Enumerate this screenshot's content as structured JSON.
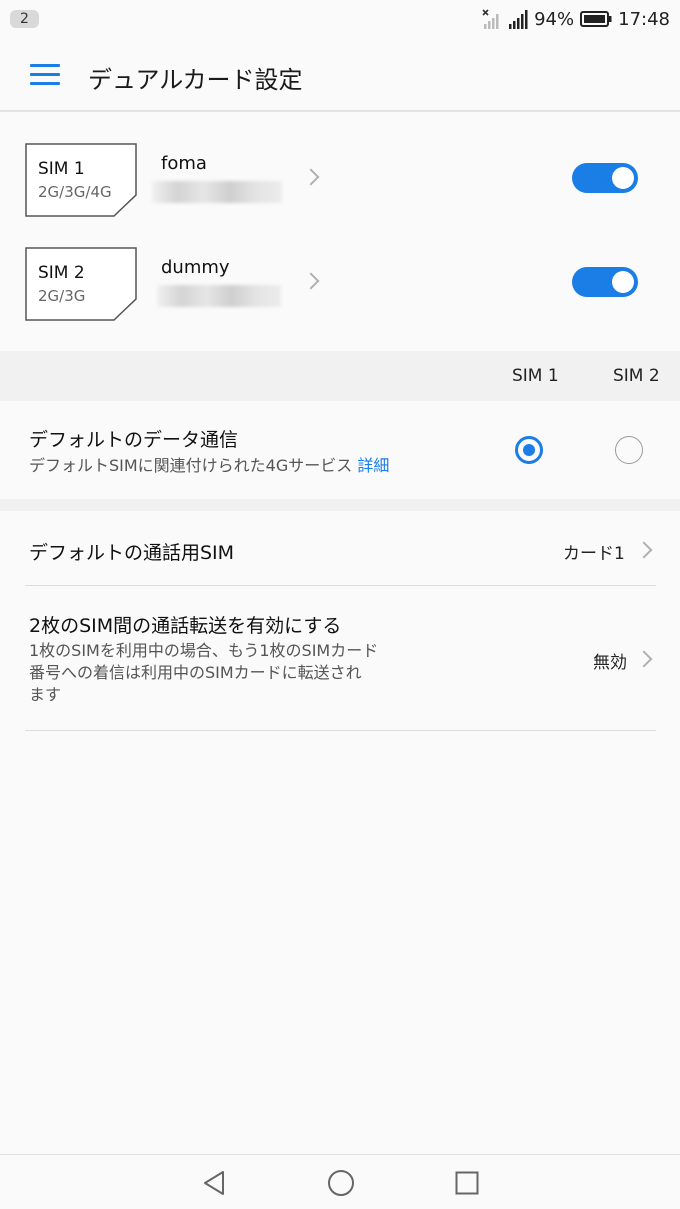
{
  "status_bar": {
    "notification_count": "2",
    "battery_percent": "94%",
    "time": "17:48",
    "icons": [
      "no-signal-icon",
      "signal-icon",
      "battery-icon"
    ]
  },
  "app_bar": {
    "title": "デュアルカード設定",
    "menu_icon": "hamburger-menu-icon"
  },
  "sims": [
    {
      "slot": "SIM 1",
      "network": "2G/3G/4G",
      "carrier": "foma",
      "enabled": true
    },
    {
      "slot": "SIM 2",
      "network": "2G/3G",
      "carrier": "dummy",
      "enabled": true
    }
  ],
  "columns": {
    "sim1": "SIM 1",
    "sim2": "SIM 2"
  },
  "default_data": {
    "title": "デフォルトのデータ通信",
    "subtitle": "デフォルトSIMに関連付けられた4Gサービス",
    "link": "詳細",
    "selected": "SIM 1"
  },
  "default_call": {
    "title": "デフォルトの通話用SIM",
    "value": "カード1"
  },
  "call_forwarding": {
    "title": "2枚のSIM間の通話転送を有効にする",
    "subtitle_line1": "1枚のSIMを利用中の場合、もう1枚のSIMカード",
    "subtitle_line2": "番号への着信は利用中のSIMカードに転送され",
    "subtitle_line3": "ます",
    "value": "無効"
  },
  "colors": {
    "accent": "#1b7de6",
    "background": "#fafafa",
    "section": "#f1f1f1"
  }
}
